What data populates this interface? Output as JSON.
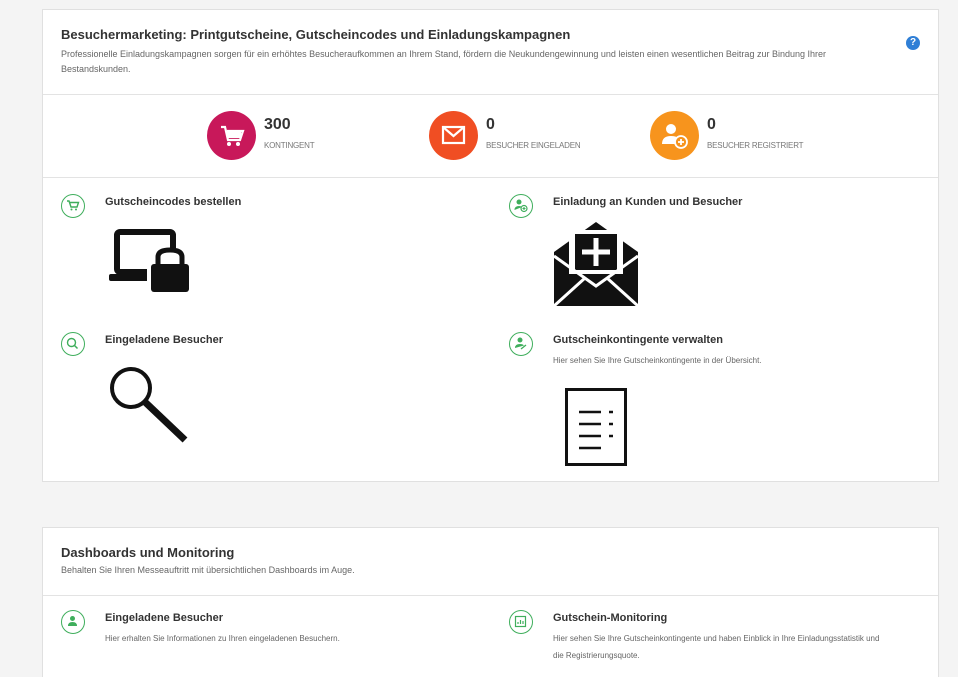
{
  "marketing": {
    "title": "Besuchermarketing: Printgutscheine, Gutscheincodes und Einladungskampagnen",
    "description": "Professionelle Einladungskampagnen sorgen für ein erhöhtes Besucheraufkommen an Ihrem Stand, fördern die Neukundengewinnung und leisten einen wesentlichen Beitrag zur Bindung Ihrer Bestandskunden.",
    "help_icon": "?",
    "stats": [
      {
        "value": "300",
        "label": "KONTINGENT",
        "icon": "cart-icon",
        "color": "#c8185a"
      },
      {
        "value": "0",
        "label": "BESUCHER EINGELADEN",
        "icon": "envelope-icon",
        "color": "#f04e23"
      },
      {
        "value": "0",
        "label": "BESUCHER REGISTRIERT",
        "icon": "user-add-icon",
        "color": "#f7941d"
      }
    ],
    "tiles": [
      {
        "title": "Gutscheincodes bestellen",
        "icon": "cart-icon",
        "illustration": "devices-lock-icon"
      },
      {
        "title": "Einladung an Kunden und Besucher",
        "icon": "user-add-icon",
        "illustration": "envelope-plus-icon"
      },
      {
        "title": "Eingeladene Besucher",
        "icon": "search-icon",
        "illustration": "magnifier-icon"
      },
      {
        "title": "Gutscheinkontingente verwalten",
        "description": "Hier sehen Sie Ihre Gutscheinkontingente in der Übersicht.",
        "icon": "user-edit-icon",
        "illustration": "document-list-icon"
      }
    ]
  },
  "monitoring": {
    "title": "Dashboards und Monitoring",
    "description": "Behalten Sie Ihren Messeauftritt mit übersichtlichen Dashboards im Auge.",
    "tiles": [
      {
        "title": "Eingeladene Besucher",
        "description": "Hier erhalten Sie Informationen zu Ihren eingeladenen Besuchern.",
        "icon": "user-icon"
      },
      {
        "title": "Gutschein-Monitoring",
        "description": "Hier sehen Sie Ihre Gutscheinkontingente und haben Einblick in Ihre Einladungsstatistik und die Registrierungsquote.",
        "icon": "chart-icon"
      }
    ]
  },
  "colors": {
    "accent_green": "#3fae5c",
    "help_blue": "#2f7fd6"
  }
}
